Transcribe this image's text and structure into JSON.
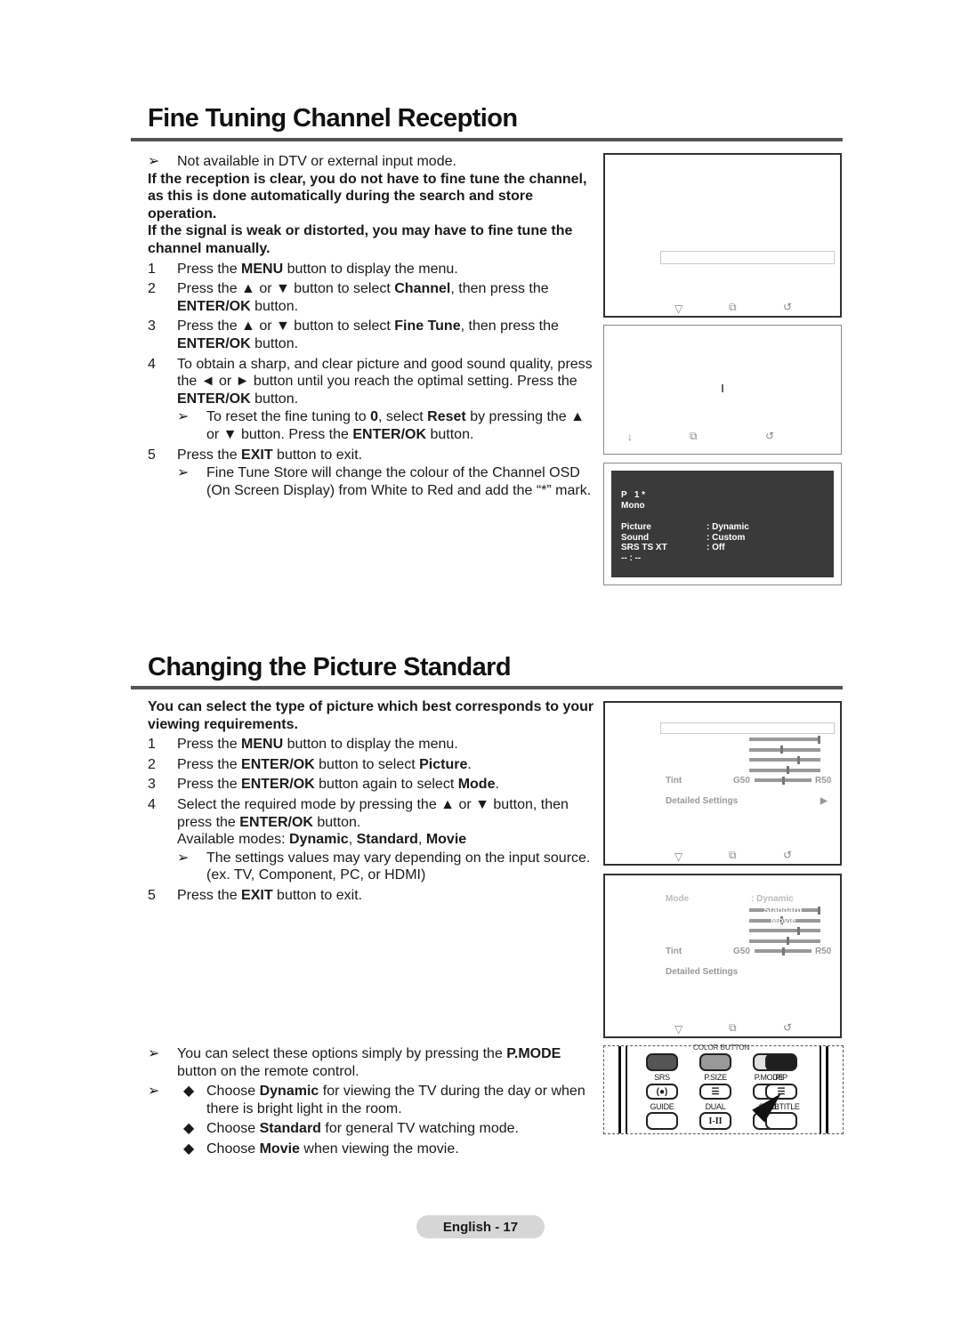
{
  "section1": {
    "title": "Fine Tuning Channel Reception",
    "blocks": [
      {
        "type": "note",
        "segs": [
          {
            "t": "Not available in DTV or external input mode."
          }
        ]
      },
      {
        "type": "boldp",
        "segs": [
          {
            "t": "If the reception is clear, you do not have to fine tune the channel, as this is done automatically during the search and store operation."
          }
        ]
      },
      {
        "type": "boldp",
        "segs": [
          {
            "t": "If the signal is weak or distorted, you may have to fine tune the channel manually."
          }
        ]
      },
      {
        "type": "step",
        "num": "1",
        "segs": [
          {
            "t": "Press the "
          },
          {
            "t": "MENU",
            "b": true
          },
          {
            "t": " button to display the menu."
          }
        ]
      },
      {
        "type": "step",
        "num": "2",
        "segs": [
          {
            "t": "Press the ▲ or ▼ button to select "
          },
          {
            "t": "Channel",
            "b": true
          },
          {
            "t": ", then press the "
          },
          {
            "t": "ENTER/OK",
            "b": true
          },
          {
            "t": " button."
          }
        ]
      },
      {
        "type": "step",
        "num": "3",
        "segs": [
          {
            "t": "Press the ▲ or ▼ button to select "
          },
          {
            "t": "Fine Tune",
            "b": true
          },
          {
            "t": ", then press the "
          },
          {
            "t": "ENTER/OK",
            "b": true
          },
          {
            "t": " button."
          }
        ]
      },
      {
        "type": "step",
        "num": "4",
        "segs": [
          {
            "t": "To obtain a sharp, and clear picture and good sound quality, press the ◄ or ► button until you reach the optimal setting. Press the "
          },
          {
            "t": "ENTER/OK",
            "b": true
          },
          {
            "t": " button."
          }
        ]
      },
      {
        "type": "subnote",
        "segs": [
          {
            "t": "To reset the fine tuning to "
          },
          {
            "t": "0",
            "b": true
          },
          {
            "t": ", select "
          },
          {
            "t": "Reset",
            "b": true
          },
          {
            "t": " by pressing the ▲ or ▼ button. Press the "
          },
          {
            "t": "ENTER/OK",
            "b": true
          },
          {
            "t": " button."
          }
        ]
      },
      {
        "type": "step",
        "num": "5",
        "segs": [
          {
            "t": "Press the "
          },
          {
            "t": "EXIT",
            "b": true
          },
          {
            "t": " button to exit."
          }
        ]
      },
      {
        "type": "subnote",
        "segs": [
          {
            "t": "Fine Tune Store will change the colour of the Channel OSD (On Screen Display) from White to Red and add the “*” mark."
          }
        ]
      }
    ]
  },
  "section2": {
    "title": "Changing the Picture Standard",
    "blocks": [
      {
        "type": "boldp",
        "segs": [
          {
            "t": "You can select the type of picture which best corresponds to your viewing requirements."
          }
        ]
      },
      {
        "type": "step",
        "num": "1",
        "segs": [
          {
            "t": "Press the "
          },
          {
            "t": "MENU",
            "b": true
          },
          {
            "t": " button to display the menu."
          }
        ]
      },
      {
        "type": "step",
        "num": "2",
        "segs": [
          {
            "t": "Press the "
          },
          {
            "t": "ENTER/OK",
            "b": true
          },
          {
            "t": " button to select "
          },
          {
            "t": "Picture",
            "b": true
          },
          {
            "t": "."
          }
        ]
      },
      {
        "type": "step",
        "num": "3",
        "segs": [
          {
            "t": "Press the "
          },
          {
            "t": "ENTER/OK",
            "b": true
          },
          {
            "t": " button again to select "
          },
          {
            "t": "Mode",
            "b": true
          },
          {
            "t": "."
          }
        ]
      },
      {
        "type": "step",
        "num": "4",
        "segs": [
          {
            "t": "Select the required mode by pressing the ▲ or ▼ button, then press the "
          },
          {
            "t": "ENTER/OK",
            "b": true
          },
          {
            "t": " button."
          }
        ]
      },
      {
        "type": "plain",
        "segs": [
          {
            "t": "Available modes: "
          },
          {
            "t": "Dynamic",
            "b": true
          },
          {
            "t": ", "
          },
          {
            "t": "Standard",
            "b": true
          },
          {
            "t": ", "
          },
          {
            "t": "Movie",
            "b": true
          }
        ]
      },
      {
        "type": "subnote",
        "segs": [
          {
            "t": "The settings values may vary depending on the input source. (ex. TV, Component, PC, or HDMI)"
          }
        ]
      },
      {
        "type": "step",
        "num": "5",
        "segs": [
          {
            "t": "Press the "
          },
          {
            "t": "EXIT",
            "b": true
          },
          {
            "t": " button to exit."
          }
        ]
      }
    ],
    "tips": [
      {
        "type": "note",
        "segs": [
          {
            "t": "You can select these options simply by pressing the "
          },
          {
            "t": "P.MODE",
            "b": true
          },
          {
            "t": " button on the remote control."
          }
        ]
      },
      {
        "type": "diamond",
        "arrow": true,
        "segs": [
          {
            "t": "Choose "
          },
          {
            "t": "Dynamic",
            "b": true
          },
          {
            "t": " for viewing the TV during the day or when there is bright light in the room."
          }
        ]
      },
      {
        "type": "diamond",
        "segs": [
          {
            "t": "Choose "
          },
          {
            "t": "Standard",
            "b": true
          },
          {
            "t": " for general TV watching mode."
          }
        ]
      },
      {
        "type": "diamond",
        "segs": [
          {
            "t": "Choose "
          },
          {
            "t": "Movie",
            "b": true
          },
          {
            "t": " when viewing the movie."
          }
        ]
      }
    ]
  },
  "osd": {
    "channel": "P   1 *",
    "sound_mode": "Mono",
    "rows": [
      {
        "k": "Picture",
        "v": ": Dynamic"
      },
      {
        "k": "Sound",
        "v": ": Custom"
      },
      {
        "k": "SRS TS XT",
        "v": ": Off"
      }
    ],
    "clock": "-- : --"
  },
  "picture_menu": {
    "tint_label": "Tint",
    "tint_left": "G50",
    "tint_right": "R50",
    "detailed": "Detailed Settings",
    "mode_label": "Mode",
    "mode_value": ": Dynamic",
    "mode_options": [
      "Dynamic",
      "Standard",
      "Movie"
    ],
    "sliders": [
      100,
      45,
      70,
      55
    ],
    "tint_value": 50
  },
  "remote": {
    "header": "COLOR BUTTON",
    "labels": [
      "SRS",
      "P.SIZE",
      "P.MODE",
      "PIP",
      "GUIDE",
      "DUAL",
      "STILL",
      "SUBTITLE"
    ],
    "dual_glyph": "I-II",
    "colors": [
      "#555555",
      "#999999",
      "#e0e0e0",
      "#1e1e1e"
    ]
  },
  "footer": "English - 17"
}
